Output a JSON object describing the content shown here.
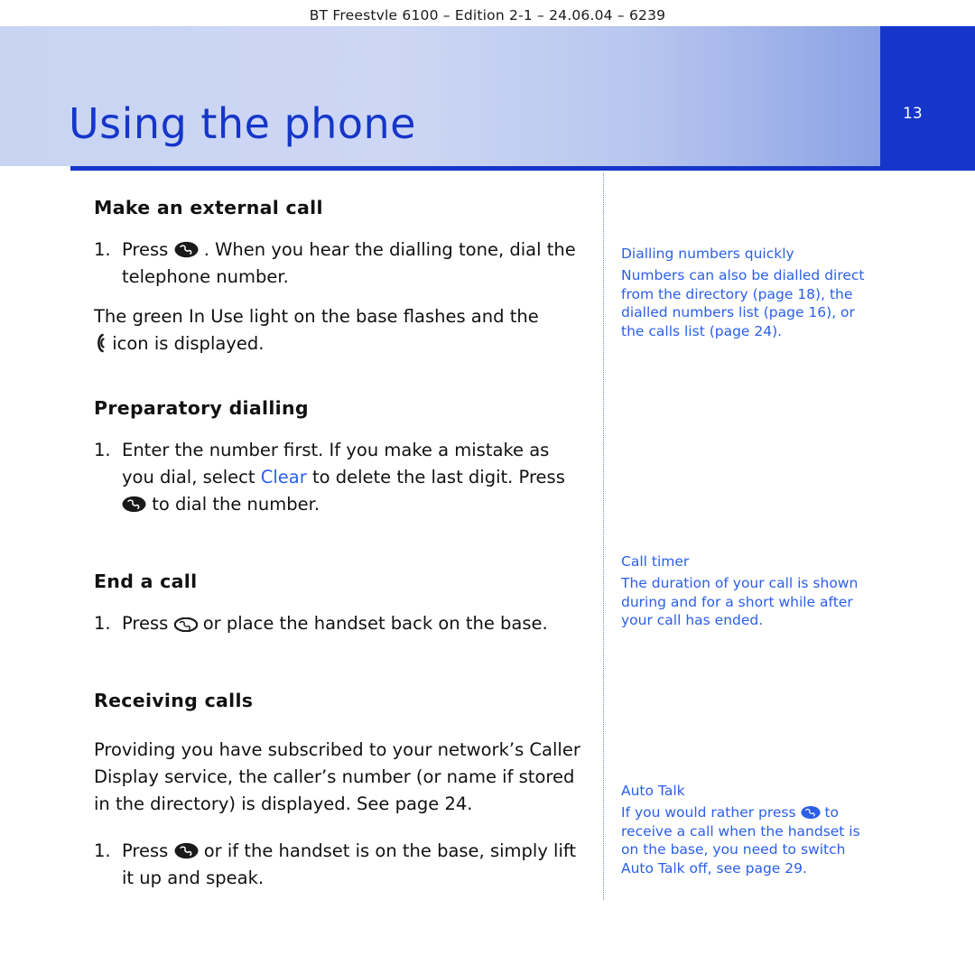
{
  "header": {
    "text": "BT Freestvle 6100 – Edition 2-1 – 24.06.04 – 6239"
  },
  "banner": {
    "title": "Using the phone",
    "page_number": "13",
    "accent_color": "#1536c8"
  },
  "main": {
    "sections": [
      {
        "heading": "Make an external call",
        "items": [
          {
            "number": "1.",
            "text_before": "Press",
            "icon": "talk-key-icon",
            "text_after": ". When you hear the dialling tone, dial the telephone number."
          }
        ],
        "paragraphs": [
          {
            "text_before": "The green In Use light on the base flashes and the",
            "icon": "in-use-indicator-icon",
            "text_after": "icon is displayed."
          }
        ]
      },
      {
        "heading": "Preparatory dialling",
        "items": [
          {
            "number": "1.",
            "text_before": "Enter the number first. If you make a mistake as you dial, select",
            "highlight": "Clear",
            "text_mid": "to delete the last digit. Press",
            "icon": "talk-key-icon",
            "text_after": "to dial the number."
          }
        ]
      },
      {
        "heading": "End a call",
        "items": [
          {
            "number": "1.",
            "text_before": "Press",
            "icon": "end-call-key-icon",
            "text_after": "or place the handset back on the base."
          }
        ]
      },
      {
        "heading": "Receiving calls",
        "paragraphs": [
          {
            "text": "Providing you have subscribed to your network’s Caller Display service, the caller’s number (or name if stored in the directory) is displayed. See page 24."
          }
        ],
        "items": [
          {
            "number": "1.",
            "text_before": "Press",
            "icon": "talk-key-icon",
            "text_after": "or if the handset is on the base, simply lift it up and speak."
          }
        ]
      }
    ]
  },
  "sidebar": {
    "notes": [
      {
        "title": "Dialling numbers quickly",
        "text": "Numbers can also be dialled direct from the directory (page 18), the dialled numbers list (page 16), or the calls list (page 24)."
      },
      {
        "title": "Call timer",
        "text": "The duration of your call is shown during and for a short while after your call has ended."
      },
      {
        "title": "Auto Talk",
        "text_before": "If you would rather press",
        "icon": "talk-key-icon",
        "text_after": "to receive a call when the handset is on the base, you need to switch Auto Talk off, see page 29."
      }
    ]
  }
}
